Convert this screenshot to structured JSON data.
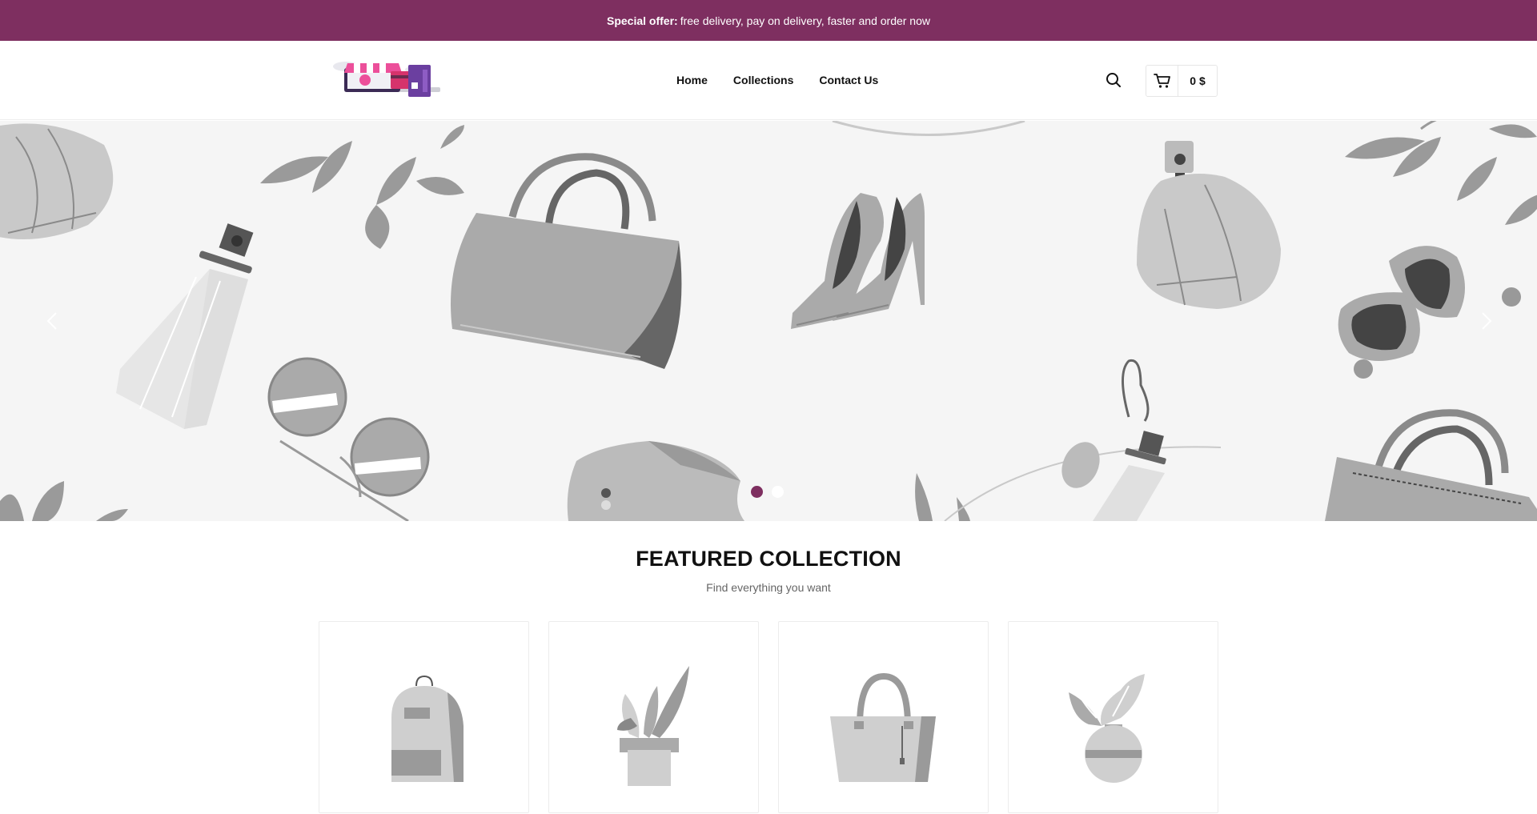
{
  "topbar": {
    "offer_label": "Special offer:",
    "offer_text": "free delivery, pay on delivery, faster and order now"
  },
  "header": {
    "logo_icon": "shop-logo-icon",
    "nav": [
      {
        "label": "Home"
      },
      {
        "label": "Collections"
      },
      {
        "label": "Contact Us"
      }
    ],
    "search_icon": "search-icon",
    "cart_icon": "cart-icon",
    "cart_total": "0 $"
  },
  "hero": {
    "prev_icon": "chevron-left-icon",
    "next_icon": "chevron-right-icon",
    "slide_count": 2,
    "active_slide": 1
  },
  "featured": {
    "title": "FEATURED COLLECTION",
    "subtitle": "Find everything you want",
    "products": [
      {
        "icon": "backpack-icon"
      },
      {
        "icon": "plant-pot-icon"
      },
      {
        "icon": "tote-bag-icon"
      },
      {
        "icon": "vase-icon"
      }
    ]
  },
  "colors": {
    "brand": "#7e2f60",
    "hero_bg": "#f5f5f5"
  }
}
